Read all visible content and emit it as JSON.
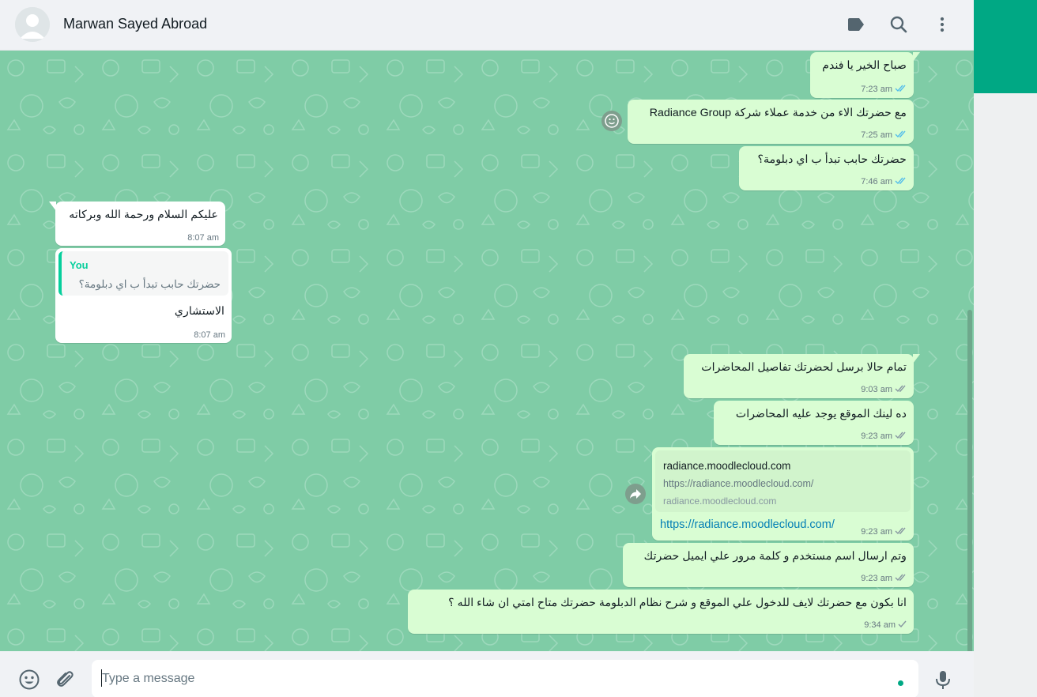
{
  "header": {
    "contact_name": "Marwan Sayed Abroad",
    "icons": [
      "labels-icon",
      "search-icon",
      "menu-icon"
    ]
  },
  "messages": [
    {
      "id": "m1",
      "dir": "out",
      "text": "صباح الخير يا فندم",
      "time": "7:23 am",
      "status": "read"
    },
    {
      "id": "m2",
      "dir": "out",
      "text": "مع حضرتك الاء من خدمة عملاء شركة Radiance Group",
      "time": "7:25 am",
      "status": "read",
      "reaction_icon": "emoji-reaction-icon"
    },
    {
      "id": "m3",
      "dir": "out",
      "text": "حضرتك حابب تبدأ ب اي دبلومة؟",
      "time": "7:46 am",
      "status": "read"
    },
    {
      "id": "m4",
      "dir": "in",
      "text": "عليكم السلام ورحمة الله وبركاته",
      "time": "8:07 am"
    },
    {
      "id": "m5",
      "dir": "in",
      "quote_author": "You",
      "quote_text": "حضرتك حابب تبدأ ب اي دبلومة؟",
      "text": "الاستشاري",
      "time": "8:07 am"
    },
    {
      "id": "m6",
      "dir": "out",
      "text": "تمام حالا برسل لحضرتك تفاصيل المحاضرات",
      "time": "9:03 am",
      "status": "delivered"
    },
    {
      "id": "m7",
      "dir": "out",
      "text": "ده لينك الموقع يوجد عليه المحاضرات",
      "time": "9:23 am",
      "status": "delivered"
    },
    {
      "id": "m8",
      "dir": "out",
      "preview_title": "radiance.moodlecloud.com",
      "preview_desc": "https://radiance.moodlecloud.com/",
      "preview_domain": "radiance.moodlecloud.com",
      "link": "https://radiance.moodlecloud.com/",
      "time": "9:23 am",
      "status": "delivered",
      "forward_icon": "forward-icon"
    },
    {
      "id": "m9",
      "dir": "out",
      "text": "وتم ارسال اسم مستخدم و كلمة مرور علي ايميل حضرتك",
      "time": "9:23 am",
      "status": "delivered"
    },
    {
      "id": "m10",
      "dir": "out",
      "text": "انا بكون مع حضرتك لايف للدخول علي الموقع و شرح نظام الدبلومة حضرتك متاح امتي ان شاء الله ؟",
      "time": "9:34 am",
      "status": "sent"
    }
  ],
  "composer": {
    "placeholder": "Type a message",
    "icons": [
      "emoji-icon",
      "attach-icon",
      "mic-icon"
    ]
  },
  "colors": {
    "wallpaper": "#7fcca6",
    "outgoing_bubble": "#d9fdd3",
    "incoming_bubble": "#ffffff",
    "read_ticks": "#53bdeb",
    "accent": "#00a884"
  }
}
